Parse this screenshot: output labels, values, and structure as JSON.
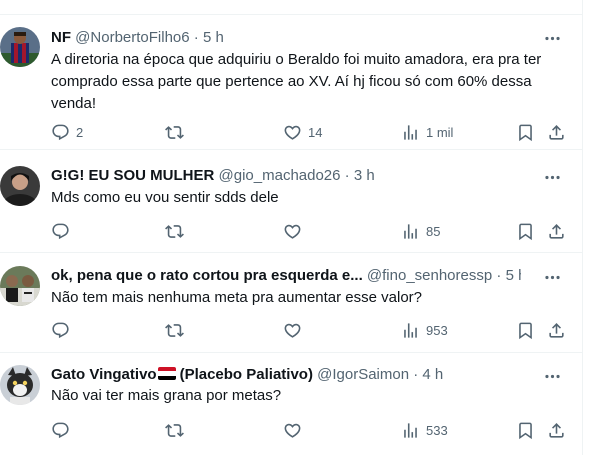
{
  "tweets": [
    {
      "name": "NF",
      "handle": "@NorbertoFilho6",
      "dot": "·",
      "time": "5 h",
      "text": "A diretoria na época que adquiriu o Beraldo foi muito amadora, era pra ter comprado essa parte que pertence ao XV. Aí hj ficou só com 60% dessa venda!",
      "replies": "2",
      "retweets": "",
      "likes": "14",
      "views": "1 mil"
    },
    {
      "name": "G!G! EU SOU MULHER",
      "handle": "@gio_machado26",
      "dot": "·",
      "time": "3 h",
      "text": "Mds como eu vou sentir sdds dele",
      "replies": "",
      "retweets": "",
      "likes": "",
      "views": "85"
    },
    {
      "name": "ok, pena que o rato cortou pra esquerda e...",
      "handle": "@fino_senhoressp",
      "dot": "·",
      "time": "5 h",
      "text": "Não tem mais nenhuma meta pra aumentar esse valor?",
      "replies": "",
      "retweets": "",
      "likes": "",
      "views": "953"
    },
    {
      "name_before_flag": "Gato Vingativo",
      "name_after_flag": "(Placebo Paliativo)",
      "handle": "@IgorSaimon",
      "dot": "·",
      "time": "4 h",
      "text": "Não vai ter mais grana por metas?",
      "replies": "",
      "retweets": "",
      "likes": "",
      "views": "533"
    }
  ],
  "colors": {
    "text": "#0f1419",
    "secondary": "#536471",
    "divider": "#eff3f4"
  },
  "icons": [
    "more-icon",
    "reply-icon",
    "retweet-icon",
    "like-icon",
    "views-icon",
    "bookmark-icon",
    "share-icon",
    "egypt-flag-icon"
  ]
}
